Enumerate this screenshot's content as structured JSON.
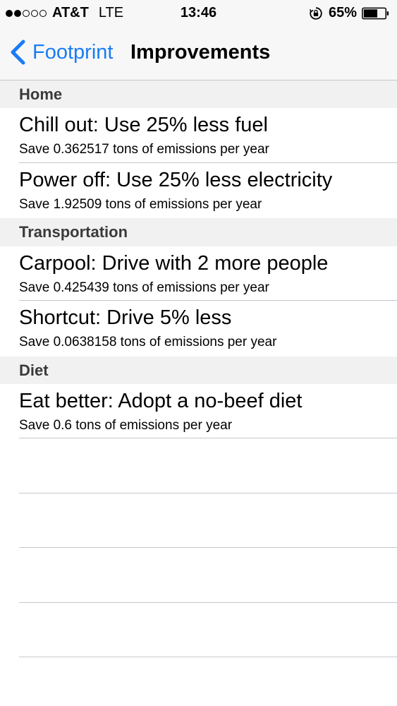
{
  "status_bar": {
    "carrier": "AT&T",
    "network": "LTE",
    "time": "13:46",
    "battery_percent": "65%",
    "battery_level": 0.65,
    "signal_strength": 2,
    "signal_max": 5,
    "icons": [
      "signal-dots",
      "rotation-lock-icon",
      "battery-icon"
    ]
  },
  "nav": {
    "back_label": "Footprint",
    "title": "Improvements",
    "accent_color": "#1a7cf5"
  },
  "sections": [
    {
      "header": "Home",
      "rows": [
        {
          "title": "Chill out: Use 25% less fuel",
          "subtitle": "Save 0.362517 tons of emissions per year"
        },
        {
          "title": "Power off: Use 25% less electricity",
          "subtitle": "Save 1.92509 tons of emissions per year"
        }
      ]
    },
    {
      "header": "Transportation",
      "rows": [
        {
          "title": "Carpool: Drive with 2 more people",
          "subtitle": "Save 0.425439 tons of emissions per year"
        },
        {
          "title": "Shortcut: Drive 5% less",
          "subtitle": "Save 0.0638158 tons of emissions per year"
        }
      ]
    },
    {
      "header": "Diet",
      "rows": [
        {
          "title": "Eat better: Adopt a no-beef diet",
          "subtitle": "Save 0.6 tons of emissions per year"
        }
      ]
    }
  ]
}
